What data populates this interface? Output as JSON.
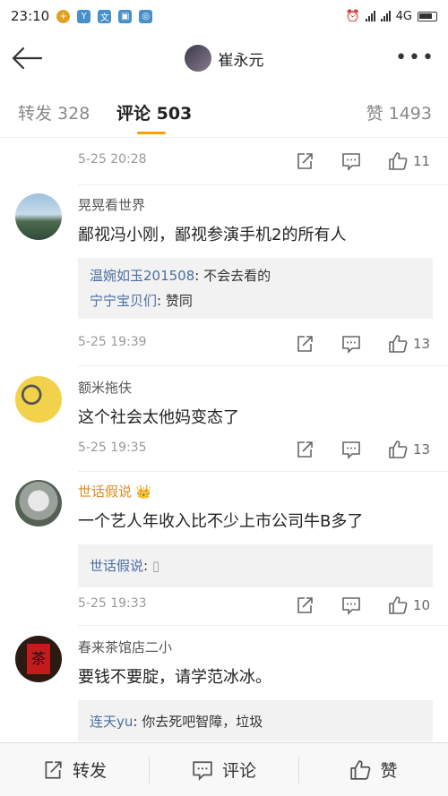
{
  "status_bar": {
    "time": "23:10",
    "network": "4G"
  },
  "header": {
    "user_name": "崔永元"
  },
  "tabs": [
    {
      "label": "转发 328"
    },
    {
      "label": "评论 503"
    },
    {
      "label": "赞 1493"
    }
  ],
  "comments": [
    {
      "time": "5-25 20:28",
      "likes": "11"
    },
    {
      "name": "晃晃看世界",
      "text": "鄙视冯小刚，鄙视参演手机2的所有人",
      "replies": [
        {
          "name": "温婉如玉201508",
          "text": ": 不会去看的"
        },
        {
          "name": "宁宁宝贝们",
          "text": ": 赞同"
        }
      ],
      "time": "5-25 19:39",
      "likes": "13"
    },
    {
      "name": "额米拖伕",
      "text": "这个社会太他妈变态了",
      "time": "5-25 19:35",
      "likes": "13"
    },
    {
      "name": "世话假说",
      "text": "一个艺人年收入比不少上市公司牛B多了",
      "replies": [
        {
          "name": "世话假说",
          "text": ":"
        }
      ],
      "time": "5-25 19:33",
      "likes": "10"
    },
    {
      "name": "春来茶馆店二小",
      "text": "要钱不要腚，请学范冰冰。",
      "replies": [
        {
          "name": "连天yu",
          "text": ": 你去死吧智障，垃圾"
        }
      ]
    }
  ],
  "bottom_bar": {
    "repost": "转发",
    "comment": "评论",
    "like": "赞"
  },
  "colors": {
    "accent": "#f6a000",
    "link": "#4a6fa3",
    "vip_name": "#e08a1f"
  }
}
